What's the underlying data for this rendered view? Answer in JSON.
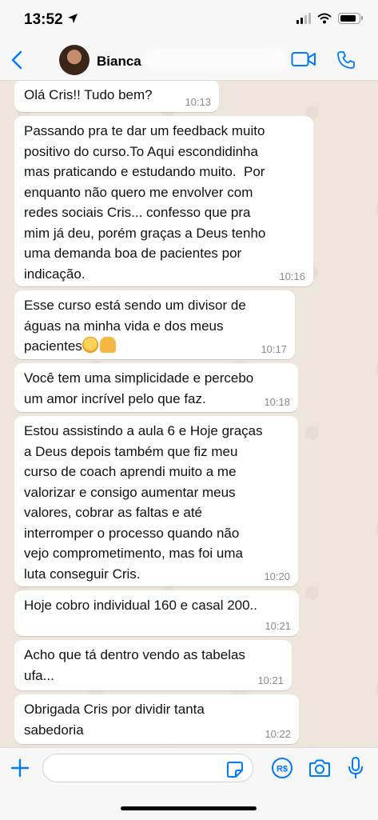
{
  "status_bar": {
    "time": "13:52"
  },
  "header": {
    "contact_name": "Bianca"
  },
  "messages": [
    {
      "text": "Olá Cris!! Tudo bem?",
      "time": "10:13"
    },
    {
      "text": "Passando pra te dar um feedback muito\npositivo do curso.To Aqui escondidinha\nmas praticando e estudando muito.  Por\nenquanto não quero me envolver com\nredes sociais Cris... confesso que pra\nmim já deu, porém graças a Deus tenho\numa demanda boa de pacientes por\nindicação.",
      "time": "10:16"
    },
    {
      "text": "Esse curso está sendo um divisor de\náguas na minha vida e dos meus\npacientes",
      "time": "10:17",
      "emojis": [
        "smiling-face-with-hearts-emoji",
        "folded-hands-emoji"
      ]
    },
    {
      "text": "Você tem uma simplicidade e percebo\num amor incrível pelo que faz.",
      "time": "10:18"
    },
    {
      "text": "Estou assistindo a aula 6 e Hoje graças\na Deus depois também que fiz meu\ncurso de coach aprendi muito a me\nvalorizar e consigo aumentar meus\nvalores, cobrar as faltas e até\ninterromper o processo quando não\nvejo comprometimento, mas foi uma\nluta conseguir Cris.",
      "time": "10:20"
    },
    {
      "text": "Hoje cobro individual 160 e casal 200..",
      "time": "10:21"
    },
    {
      "text": "Acho que tá dentro vendo as tabelas\nufa...",
      "time": "10:21"
    },
    {
      "text": "Obrigada Cris por dividir tanta\nsabedoria",
      "time": "10:22"
    }
  ],
  "colors": {
    "accent": "#007aff",
    "chat_background": "#eee6dc",
    "bubble": "#ffffff",
    "time_text": "#8a8a8a"
  },
  "icons": [
    "location-arrow-icon",
    "signal-icon",
    "wifi-icon",
    "battery-icon",
    "back-chevron-icon",
    "video-call-icon",
    "phone-call-icon",
    "plus-icon",
    "sticker-icon",
    "payment-icon",
    "camera-icon",
    "microphone-icon"
  ]
}
